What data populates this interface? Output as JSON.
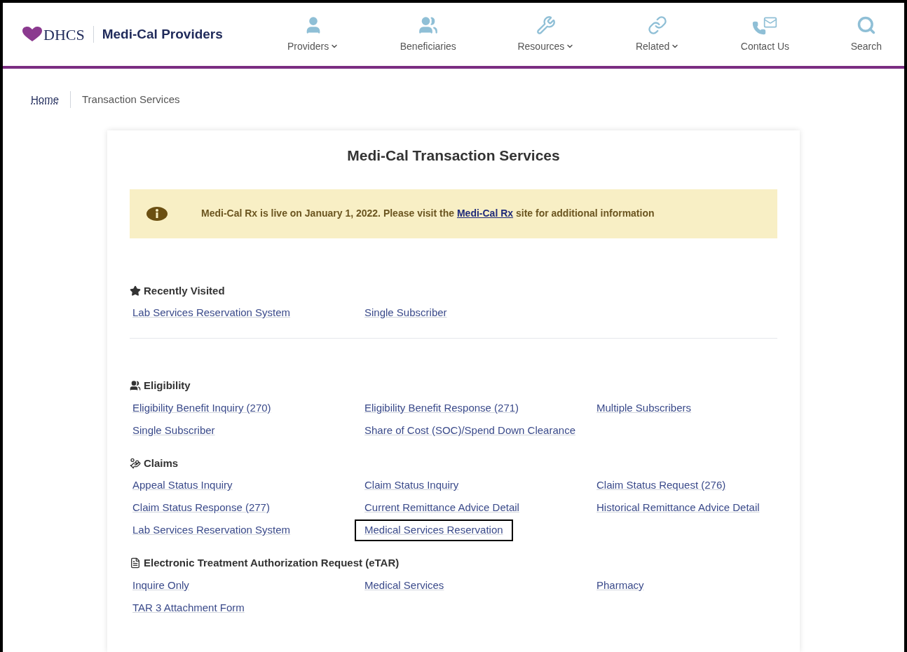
{
  "header": {
    "logo_text": "DHCS",
    "site_title": "Medi-Cal Providers",
    "nav": [
      {
        "kind": "person",
        "label": "Providers",
        "has_menu": true
      },
      {
        "kind": "people",
        "label": "Beneficiaries",
        "has_menu": false
      },
      {
        "kind": "tools",
        "label": "Resources",
        "has_menu": true
      },
      {
        "kind": "link",
        "label": "Related",
        "has_menu": true
      },
      {
        "kind": "contact",
        "label": "Contact Us",
        "has_menu": false
      },
      {
        "kind": "search",
        "label": "Search",
        "has_menu": false
      }
    ]
  },
  "breadcrumb": [
    {
      "label": "Home",
      "link": true
    },
    {
      "label": "Transaction Services",
      "link": false
    }
  ],
  "page_title": "Medi-Cal Transaction Services",
  "notice": {
    "before": "Medi-Cal Rx is live on January 1, 2022. Please visit the",
    "link": "Medi-Cal Rx",
    "after": "site for additional information"
  },
  "sections": [
    {
      "kind": "star",
      "title": "Recently Visited",
      "divider": true,
      "links": [
        {
          "label": "Lab Services Reservation System",
          "highlighted": false
        },
        {
          "label": "Single Subscriber",
          "highlighted": false
        }
      ]
    },
    {
      "kind": "eligibility",
      "title": "Eligibility",
      "divider": false,
      "links": [
        {
          "label": "Eligibility Benefit Inquiry (270)",
          "highlighted": false
        },
        {
          "label": "Eligibility Benefit Response (271)",
          "highlighted": false
        },
        {
          "label": "Multiple Subscribers",
          "highlighted": false
        },
        {
          "label": "Single Subscriber",
          "highlighted": false
        },
        {
          "label": "Share of Cost (SOC)/Spend Down Clearance",
          "highlighted": false
        }
      ]
    },
    {
      "kind": "claims",
      "title": "Claims",
      "divider": false,
      "links": [
        {
          "label": "Appeal Status Inquiry",
          "highlighted": false
        },
        {
          "label": "Claim Status Inquiry",
          "highlighted": false
        },
        {
          "label": "Claim Status Request (276)",
          "highlighted": false
        },
        {
          "label": "Claim Status Response (277)",
          "highlighted": false
        },
        {
          "label": "Current Remittance Advice Detail",
          "highlighted": false
        },
        {
          "label": "Historical Remittance Advice Detail",
          "highlighted": false
        },
        {
          "label": "Lab Services Reservation System",
          "highlighted": false
        },
        {
          "label": "Medical Services Reservation",
          "highlighted": true
        }
      ]
    },
    {
      "kind": "document",
      "title": "Electronic Treatment Authorization Request (eTAR)",
      "divider": false,
      "links": [
        {
          "label": "Inquire Only",
          "highlighted": false
        },
        {
          "label": "Medical Services",
          "highlighted": false
        },
        {
          "label": "Pharmacy",
          "highlighted": false
        },
        {
          "label": "TAR 3 Attachment Form",
          "highlighted": false
        }
      ]
    }
  ]
}
